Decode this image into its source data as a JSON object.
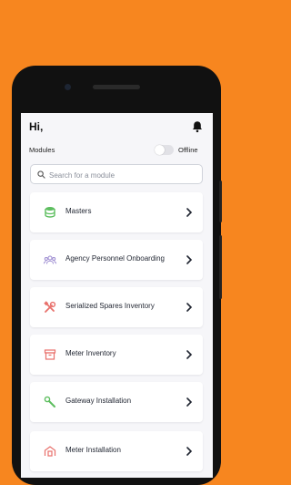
{
  "header": {
    "greeting": "Hi,"
  },
  "modules": {
    "label": "Modules",
    "offline_label": "Offline"
  },
  "search": {
    "placeholder": "Search for a module"
  },
  "items": [
    {
      "label": "Masters",
      "icon": "database-icon",
      "color": "#5DBE5F"
    },
    {
      "label": "Agency Personnel Onboarding",
      "icon": "people-icon",
      "color": "#9B8AD0"
    },
    {
      "label": "Serialized Spares Inventory",
      "icon": "tools-icon",
      "color": "#E8706B"
    },
    {
      "label": "Meter Inventory",
      "icon": "archive-box-icon",
      "color": "#E8706B"
    },
    {
      "label": "Gateway Installation",
      "icon": "wrench-icon",
      "color": "#5DBE5F"
    },
    {
      "label": "Meter Installation",
      "icon": "installation-icon",
      "color": "#E8706B"
    }
  ],
  "colors": {
    "background": "#F7861F",
    "screen": "#F6F6F9"
  }
}
